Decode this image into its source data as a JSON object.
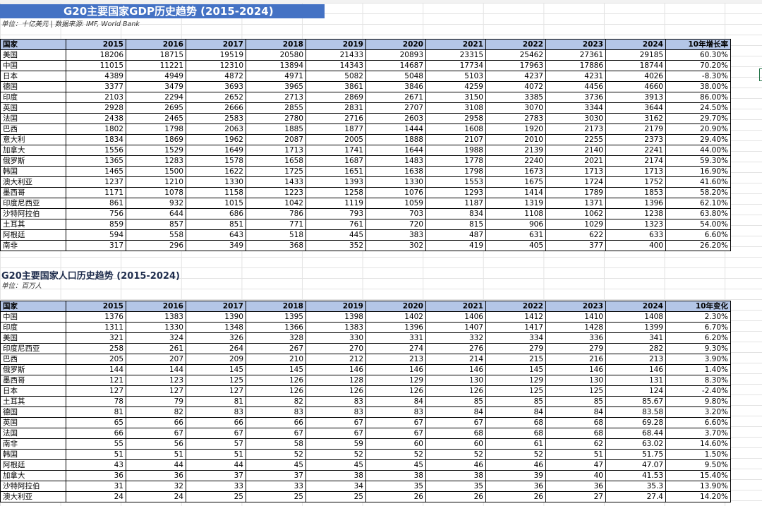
{
  "sheet": {
    "gdp_title": "G20主要国家GDP历史趋势 (2015-2024)",
    "gdp_subtitle": "单位：十亿美元 | 数据来源: IMF, World Bank",
    "pop_title": "G20主要国家人口历史趋势 (2015-2024)",
    "pop_subtitle": "单位：百万人"
  },
  "gdp": {
    "headers": [
      "国家",
      "2015",
      "2016",
      "2017",
      "2018",
      "2019",
      "2020",
      "2021",
      "2022",
      "2023",
      "2024",
      "10年增长率"
    ],
    "rows": [
      [
        "美国",
        "18206",
        "18715",
        "19519",
        "20580",
        "21433",
        "20893",
        "23315",
        "25462",
        "27361",
        "29185",
        "60.30%"
      ],
      [
        "中国",
        "11015",
        "11221",
        "12310",
        "13894",
        "14343",
        "14687",
        "17734",
        "17963",
        "17886",
        "18744",
        "70.20%"
      ],
      [
        "日本",
        "4389",
        "4949",
        "4872",
        "4971",
        "5082",
        "5048",
        "5103",
        "4237",
        "4231",
        "4026",
        "-8.30%"
      ],
      [
        "德国",
        "3377",
        "3479",
        "3693",
        "3965",
        "3861",
        "3846",
        "4259",
        "4072",
        "4456",
        "4660",
        "38.00%"
      ],
      [
        "印度",
        "2103",
        "2294",
        "2652",
        "2713",
        "2869",
        "2671",
        "3150",
        "3385",
        "3736",
        "3913",
        "86.00%"
      ],
      [
        "英国",
        "2928",
        "2695",
        "2666",
        "2855",
        "2831",
        "2707",
        "3108",
        "3070",
        "3344",
        "3644",
        "24.50%"
      ],
      [
        "法国",
        "2438",
        "2465",
        "2583",
        "2780",
        "2716",
        "2603",
        "2958",
        "2783",
        "3030",
        "3162",
        "29.70%"
      ],
      [
        "巴西",
        "1802",
        "1798",
        "2063",
        "1885",
        "1877",
        "1444",
        "1608",
        "1920",
        "2173",
        "2179",
        "20.90%"
      ],
      [
        "意大利",
        "1834",
        "1869",
        "1962",
        "2087",
        "2005",
        "1888",
        "2107",
        "2010",
        "2255",
        "2373",
        "29.40%"
      ],
      [
        "加拿大",
        "1556",
        "1529",
        "1649",
        "1713",
        "1741",
        "1644",
        "1988",
        "2139",
        "2140",
        "2241",
        "44.00%"
      ],
      [
        "俄罗斯",
        "1365",
        "1283",
        "1578",
        "1658",
        "1687",
        "1483",
        "1778",
        "2240",
        "2021",
        "2174",
        "59.30%"
      ],
      [
        "韩国",
        "1465",
        "1500",
        "1622",
        "1725",
        "1651",
        "1638",
        "1798",
        "1673",
        "1713",
        "1713",
        "16.90%"
      ],
      [
        "澳大利亚",
        "1237",
        "1210",
        "1330",
        "1433",
        "1393",
        "1330",
        "1553",
        "1675",
        "1724",
        "1752",
        "41.60%"
      ],
      [
        "墨西哥",
        "1171",
        "1078",
        "1158",
        "1223",
        "1258",
        "1076",
        "1293",
        "1414",
        "1789",
        "1853",
        "58.20%"
      ],
      [
        "印度尼西亚",
        "861",
        "932",
        "1015",
        "1042",
        "1119",
        "1059",
        "1187",
        "1319",
        "1371",
        "1396",
        "62.10%"
      ],
      [
        "沙特阿拉伯",
        "756",
        "644",
        "686",
        "786",
        "793",
        "703",
        "834",
        "1108",
        "1062",
        "1238",
        "63.80%"
      ],
      [
        "土耳其",
        "859",
        "857",
        "851",
        "771",
        "761",
        "720",
        "815",
        "906",
        "1029",
        "1323",
        "54.00%"
      ],
      [
        "阿根廷",
        "594",
        "558",
        "643",
        "518",
        "445",
        "383",
        "487",
        "631",
        "622",
        "633",
        "6.60%"
      ],
      [
        "南非",
        "317",
        "296",
        "349",
        "368",
        "352",
        "302",
        "419",
        "405",
        "377",
        "400",
        "26.20%"
      ]
    ]
  },
  "pop": {
    "headers": [
      "国家",
      "2015",
      "2016",
      "2017",
      "2018",
      "2019",
      "2020",
      "2021",
      "2022",
      "2023",
      "2024",
      "10年变化"
    ],
    "rows": [
      [
        "中国",
        "1376",
        "1383",
        "1390",
        "1395",
        "1398",
        "1402",
        "1406",
        "1412",
        "1410",
        "1408",
        "2.30%"
      ],
      [
        "印度",
        "1311",
        "1330",
        "1348",
        "1366",
        "1383",
        "1396",
        "1407",
        "1417",
        "1428",
        "1399",
        "6.70%"
      ],
      [
        "美国",
        "321",
        "324",
        "326",
        "328",
        "330",
        "331",
        "332",
        "334",
        "336",
        "341",
        "6.20%"
      ],
      [
        "印度尼西亚",
        "258",
        "261",
        "264",
        "267",
        "270",
        "274",
        "276",
        "279",
        "279",
        "282",
        "9.30%"
      ],
      [
        "巴西",
        "205",
        "207",
        "209",
        "210",
        "212",
        "213",
        "214",
        "215",
        "216",
        "213",
        "3.90%"
      ],
      [
        "俄罗斯",
        "144",
        "144",
        "145",
        "145",
        "146",
        "146",
        "146",
        "145",
        "146",
        "146",
        "1.40%"
      ],
      [
        "墨西哥",
        "121",
        "123",
        "125",
        "126",
        "128",
        "129",
        "130",
        "129",
        "130",
        "131",
        "8.30%"
      ],
      [
        "日本",
        "127",
        "127",
        "127",
        "126",
        "126",
        "126",
        "126",
        "125",
        "125",
        "124",
        "-2.40%"
      ],
      [
        "土耳其",
        "78",
        "79",
        "81",
        "82",
        "83",
        "84",
        "85",
        "85",
        "85",
        "85.67",
        "9.80%"
      ],
      [
        "德国",
        "81",
        "82",
        "83",
        "83",
        "83",
        "83",
        "84",
        "84",
        "84",
        "83.58",
        "3.20%"
      ],
      [
        "英国",
        "65",
        "66",
        "66",
        "66",
        "67",
        "67",
        "67",
        "68",
        "68",
        "69.28",
        "6.60%"
      ],
      [
        "法国",
        "66",
        "67",
        "67",
        "67",
        "67",
        "67",
        "68",
        "68",
        "68",
        "68.44",
        "3.70%"
      ],
      [
        "南非",
        "55",
        "56",
        "57",
        "58",
        "59",
        "60",
        "60",
        "61",
        "62",
        "63.02",
        "14.60%"
      ],
      [
        "韩国",
        "51",
        "51",
        "51",
        "52",
        "52",
        "52",
        "52",
        "52",
        "51",
        "51.75",
        "1.50%"
      ],
      [
        "阿根廷",
        "43",
        "44",
        "44",
        "45",
        "45",
        "45",
        "46",
        "46",
        "47",
        "47.07",
        "9.50%"
      ],
      [
        "加拿大",
        "36",
        "36",
        "37",
        "37",
        "38",
        "38",
        "38",
        "39",
        "40",
        "41.53",
        "15.40%"
      ],
      [
        "沙特阿拉伯",
        "31",
        "32",
        "33",
        "33",
        "34",
        "35",
        "35",
        "36",
        "36",
        "35.3",
        "13.90%"
      ],
      [
        "澳大利亚",
        "24",
        "24",
        "25",
        "25",
        "25",
        "26",
        "26",
        "26",
        "27",
        "27.4",
        "14.20%"
      ]
    ]
  }
}
